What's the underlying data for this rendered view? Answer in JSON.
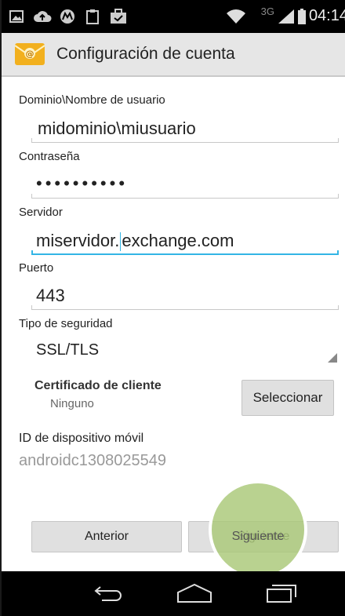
{
  "status_bar": {
    "left_icons": [
      "image-icon",
      "cloud-upload-icon",
      "motorola-icon",
      "clipboard-icon",
      "briefcase-check-icon"
    ],
    "network": "3G",
    "time": "04:14"
  },
  "header": {
    "app_icon": "mail-envelope-icon",
    "title": "Configuración de cuenta"
  },
  "form": {
    "domain_user": {
      "label": "Dominio\\Nombre de usuario",
      "value": "midominio\\miusuario"
    },
    "password": {
      "label": "Contraseña",
      "value": "••••••••••"
    },
    "server": {
      "label": "Servidor",
      "value_before_cursor": "miservidor.",
      "value_after_cursor": "exchange.com"
    },
    "port": {
      "label": "Puerto",
      "value": "443"
    },
    "security": {
      "label": "Tipo de seguridad",
      "value": "SSL/TLS"
    },
    "client_cert": {
      "label": "Certificado de cliente",
      "value": "Ninguno",
      "button": "Seleccionar"
    },
    "device_id": {
      "label": "ID de dispositivo móvil",
      "value": "androidc1308025549"
    }
  },
  "buttons": {
    "previous": "Anterior",
    "next": "Siguiente"
  },
  "nav_bar": {
    "back": "back-icon",
    "home": "home-icon",
    "recents": "recents-icon"
  },
  "colors": {
    "accent": "#33b5e5",
    "highlight": "#aac878"
  }
}
